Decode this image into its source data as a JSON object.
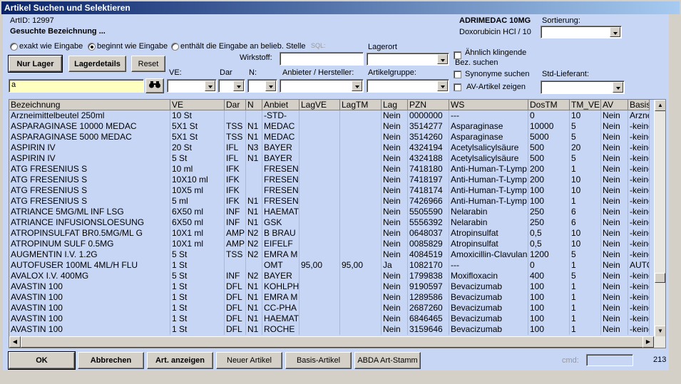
{
  "title": "Artikel Suchen und Selektieren",
  "header": {
    "artid_label": "ArtID: 12997",
    "gesuchte": "Gesuchte Bezeichnung ...",
    "product_name": "ADRIMEDAC 10MG",
    "product_sub": "Doxorubicin HCl / 10",
    "sortierung_label": "Sortierung:"
  },
  "radios": [
    {
      "label": "exakt wie Eingabe",
      "checked": false
    },
    {
      "label": "beginnt wie Eingabe",
      "checked": true
    },
    {
      "label": "enthält die Eingabe an belieb. Stelle",
      "checked": false
    }
  ],
  "sql_label": "SQL:",
  "buttons": {
    "nur_lager": "Nur Lager",
    "lagerdetails": "Lagerdetails",
    "reset": "Reset",
    "ok": "OK",
    "abbrechen": "Abbrechen",
    "art_anzeigen": "Art. anzeigen",
    "neuer_artikel": "Neuer Artikel",
    "basis_artikel": "Basis-Artikel",
    "abda": "ABDA Art-Stamm"
  },
  "fields": {
    "wirkstoff_label": "Wirkstoff:",
    "lagerort_label": "Lagerort",
    "ve_label": "VE:",
    "dar_label": "Dar",
    "n_label": "N:",
    "anbieter_label": "Anbieter / Hersteller:",
    "artikelgruppe_label": "Artikelgruppe:",
    "search_value": "a",
    "std_lieferant_label": "Std-Lieferant:",
    "cmd_label": "cmd:",
    "count": "213"
  },
  "checks": [
    {
      "label1": "Ähnlich klingende",
      "label2": "Bez. suchen"
    },
    {
      "label1": "Synonyme suchen"
    },
    {
      "label1": "AV-Artikel zeigen"
    }
  ],
  "columns": [
    "Bezeichnung",
    "VE",
    "Dar",
    "N",
    "Anbiet",
    "LagVE",
    "LagTM",
    "Lag",
    "PZN",
    "WS",
    "DosTM",
    "TM_VE",
    "AV",
    "BasisA"
  ],
  "rows": [
    [
      "Arzneimittelbeutel 250ml",
      "10 St",
      "",
      "",
      "-STD-",
      "",
      "",
      "Nein",
      "0000000",
      "---",
      "0",
      "10",
      "Nein",
      "Arzne"
    ],
    [
      "ASPARAGINASE 10000 MEDAC",
      "5X1 St",
      "TSS",
      "N1",
      "MEDAC",
      "",
      "",
      "Nein",
      "3514277",
      "Asparaginase",
      "10000",
      "5",
      "Nein",
      "-keine"
    ],
    [
      "ASPARAGINASE 5000 MEDAC",
      "5X1 St",
      "TSS",
      "N1",
      "MEDAC",
      "",
      "",
      "Nein",
      "3514260",
      "Asparaginase",
      "5000",
      "5",
      "Nein",
      "-keine"
    ],
    [
      "ASPIRIN IV",
      "20 St",
      "IFL",
      "N3",
      "BAYER",
      "",
      "",
      "Nein",
      "4324194",
      "Acetylsalicylsäure",
      "500",
      "20",
      "Nein",
      "-keine"
    ],
    [
      "ASPIRIN IV",
      "5 St",
      "IFL",
      "N1",
      "BAYER",
      "",
      "",
      "Nein",
      "4324188",
      "Acetylsalicylsäure",
      "500",
      "5",
      "Nein",
      "-keine"
    ],
    [
      "ATG FRESENIUS S",
      "10 ml",
      "IFK",
      "",
      "FRESEN",
      "",
      "",
      "Nein",
      "7418180",
      "Anti-Human-T-Lymp",
      "200",
      "1",
      "Nein",
      "-keine"
    ],
    [
      "ATG FRESENIUS S",
      "10X10 ml",
      "IFK",
      "",
      "FRESEN",
      "",
      "",
      "Nein",
      "7418197",
      "Anti-Human-T-Lymp",
      "200",
      "10",
      "Nein",
      "-keine"
    ],
    [
      "ATG FRESENIUS S",
      "10X5 ml",
      "IFK",
      "",
      "FRESEN",
      "",
      "",
      "Nein",
      "7418174",
      "Anti-Human-T-Lymp",
      "100",
      "10",
      "Nein",
      "-keine"
    ],
    [
      "ATG FRESENIUS S",
      "5 ml",
      "IFK",
      "N1",
      "FRESEN",
      "",
      "",
      "Nein",
      "7426966",
      "Anti-Human-T-Lymp",
      "100",
      "1",
      "Nein",
      "-keine"
    ],
    [
      "ATRIANCE 5MG/ML INF LSG",
      "6X50 ml",
      "INF",
      "N1",
      "HAEMAT",
      "",
      "",
      "Nein",
      "5505590",
      "Nelarabin",
      "250",
      "6",
      "Nein",
      "-keine"
    ],
    [
      "ATRIANCE INFUSIONSLOESUNG",
      "6X50 ml",
      "INF",
      "N1",
      "GSK",
      "",
      "",
      "Nein",
      "5556392",
      "Nelarabin",
      "250",
      "6",
      "Nein",
      "-keine"
    ],
    [
      "ATROPINSULFAT BR0.5MG/ML G",
      "10X1 ml",
      "AMP",
      "N2",
      "B BRAU",
      "",
      "",
      "Nein",
      "0648037",
      "Atropinsulfat",
      "0,5",
      "10",
      "Nein",
      "-keine"
    ],
    [
      "ATROPINUM SULF 0.5MG",
      "10X1 ml",
      "AMP",
      "N2",
      "EIFELF",
      "",
      "",
      "Nein",
      "0085829",
      "Atropinsulfat",
      "0,5",
      "10",
      "Nein",
      "-keine"
    ],
    [
      "AUGMENTIN I.V. 1.2G",
      "5 St",
      "TSS",
      "N2",
      "EMRA M",
      "",
      "",
      "Nein",
      "4084519",
      "Amoxicillin-Clavulansä",
      "1200",
      "5",
      "Nein",
      "-keine"
    ],
    [
      "AUTOFUSER 100ML 4ML/H FLU",
      "1 St",
      "",
      "",
      "OMT",
      "95,00",
      "95,00",
      "Ja",
      "1082170",
      "---",
      "0",
      "1",
      "Nein",
      "AUTO"
    ],
    [
      "AVALOX I.V. 400MG",
      "5 St",
      "INF",
      "N2",
      "BAYER",
      "",
      "",
      "Nein",
      "1799838",
      "Moxifloxacin",
      "400",
      "5",
      "Nein",
      "-keine"
    ],
    [
      "AVASTIN 100",
      "1 St",
      "DFL",
      "N1",
      "KOHLPH",
      "",
      "",
      "Nein",
      "9190597",
      "Bevacizumab",
      "100",
      "1",
      "Nein",
      "-keine"
    ],
    [
      "AVASTIN 100",
      "1 St",
      "DFL",
      "N1",
      "EMRA M",
      "",
      "",
      "Nein",
      "1289586",
      "Bevacizumab",
      "100",
      "1",
      "Nein",
      "-keine"
    ],
    [
      "AVASTIN 100",
      "1 St",
      "DFL",
      "N1",
      "CC-PHA",
      "",
      "",
      "Nein",
      "2687260",
      "Bevacizumab",
      "100",
      "1",
      "Nein",
      "-keine"
    ],
    [
      "AVASTIN 100",
      "1 St",
      "DFL",
      "N1",
      "HAEMAT",
      "",
      "",
      "Nein",
      "6846465",
      "Bevacizumab",
      "100",
      "1",
      "Nein",
      "-keine"
    ],
    [
      "AVASTIN 100",
      "1 St",
      "DFL",
      "N1",
      "ROCHE",
      "",
      "",
      "Nein",
      "3159646",
      "Bevacizumab",
      "100",
      "1",
      "Nein",
      "-keine"
    ]
  ],
  "colors": {
    "client_bg": "#c7d6f5",
    "title_start": "#0a246a",
    "search_bg": "#ffffc0"
  }
}
